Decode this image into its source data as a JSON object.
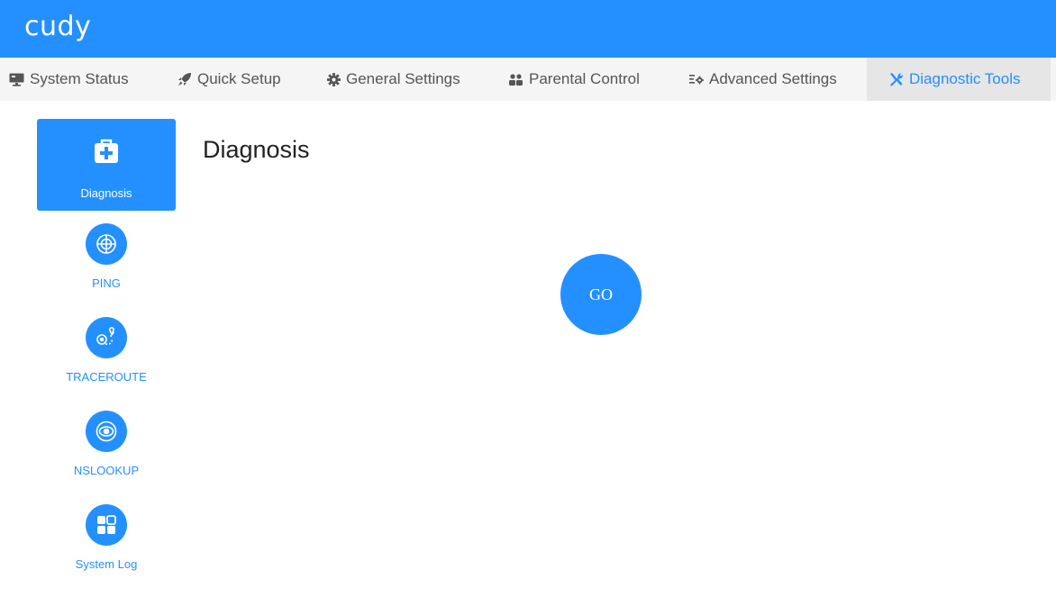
{
  "brand": {
    "logo_text": "cudy",
    "color": "#2490ff"
  },
  "nav": {
    "items": [
      {
        "label": "System Status",
        "icon": "monitor-icon"
      },
      {
        "label": "Quick Setup",
        "icon": "rocket-icon"
      },
      {
        "label": "General Settings",
        "icon": "gear-icon"
      },
      {
        "label": "Parental Control",
        "icon": "users-icon"
      },
      {
        "label": "Advanced Settings",
        "icon": "list-gear-icon"
      },
      {
        "label": "Diagnostic Tools",
        "icon": "wrench-screwdriver-icon",
        "active": true
      }
    ]
  },
  "sidebar": {
    "items": [
      {
        "label": "Diagnosis",
        "icon": "medical-kit-icon",
        "active": true
      },
      {
        "label": "PING",
        "icon": "globe-target-icon"
      },
      {
        "label": "TRACEROUTE",
        "icon": "route-icon"
      },
      {
        "label": "NSLOOKUP",
        "icon": "eye-target-icon"
      },
      {
        "label": "System Log",
        "icon": "grid-icon"
      }
    ]
  },
  "main": {
    "title": "Diagnosis",
    "go_label": "GO"
  }
}
